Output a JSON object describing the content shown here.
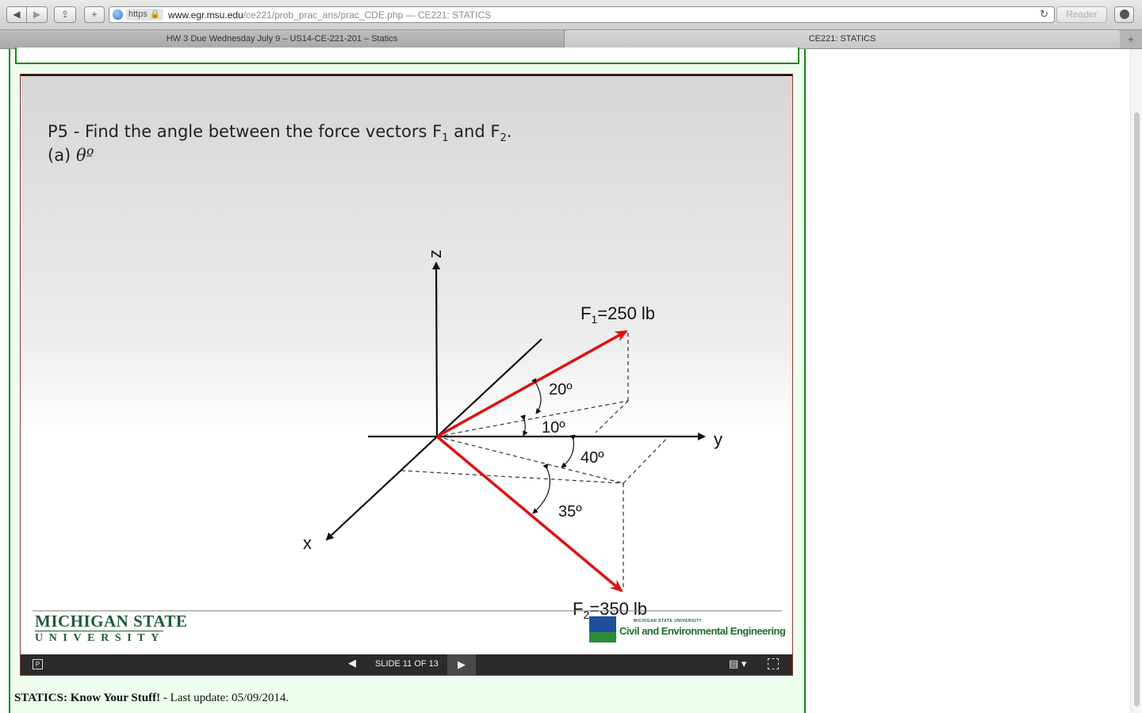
{
  "browser": {
    "url_scheme": "https",
    "url_host": "www.egr.msu.edu",
    "url_path": "/ce221/prob_prac_ans/prac_CDE.php",
    "url_title_suffix": " — CE221: STATICS",
    "reader_label": "Reader",
    "new_tab_icon": "+"
  },
  "tabs": [
    {
      "label": "HW 3 Due Wednesday July 9 – US14-CE-221-201 – Statics"
    },
    {
      "label": "CE221: STATICS"
    }
  ],
  "slide": {
    "question_line1": "P5 - Find the angle between the force vectors F",
    "q_sub1": "1",
    "q_and": " and F",
    "q_sub2": "2",
    "q_end": ".",
    "question_line2_prefix": "(a) ",
    "question_line2_symbol": "θº",
    "axis_z": "z",
    "axis_y": "y",
    "axis_x": "x",
    "f1_label_prefix": "F",
    "f1_sub": "1",
    "f1_label_suffix": "=250 lb",
    "f2_label_prefix": "F",
    "f2_sub": "2",
    "f2_label_suffix": "=350 lb",
    "angle_20": "20º",
    "angle_10": "10º",
    "angle_40": "40º",
    "angle_35": "35º",
    "colors": {
      "vector": "#e01010",
      "axis": "#111111"
    }
  },
  "logos": {
    "msu_line1": "MICHIGAN STATE",
    "msu_line2": "UNIVERSITY",
    "cee_small": "MICHIGAN STATE UNIVERSITY",
    "cee_big": "Civil and Environmental Engineering"
  },
  "player": {
    "slide_counter": "SLIDE 11 OF 13",
    "prev_icon": "◀",
    "next_icon": "▶",
    "notes_icon": "▤ ▾"
  },
  "footer": {
    "bold": "STATICS: Know Your Stuff!",
    "rest": " - Last update: 05/09/2014."
  }
}
